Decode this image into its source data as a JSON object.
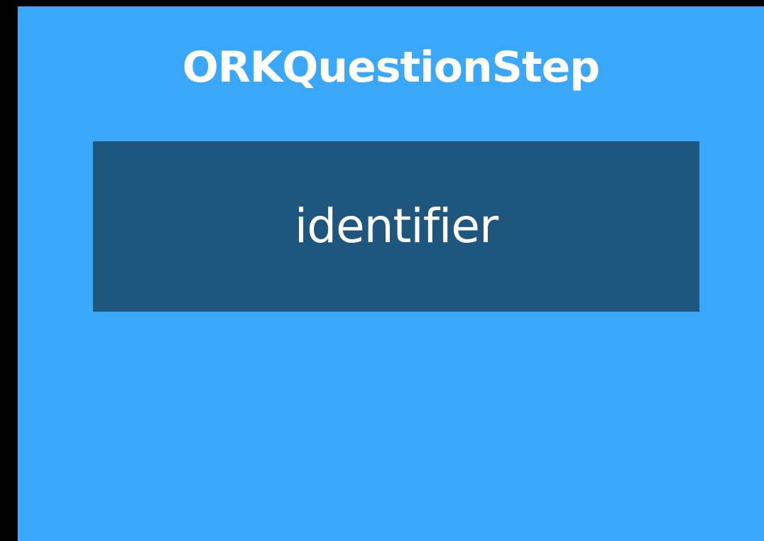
{
  "diagram": {
    "title": "ORKQuestionStep",
    "properties": [
      {
        "label": "identifier"
      }
    ]
  },
  "colors": {
    "background": "#000000",
    "panel": "#3aa7f8",
    "property_box": "#1e567e",
    "text": "#ffffff"
  }
}
